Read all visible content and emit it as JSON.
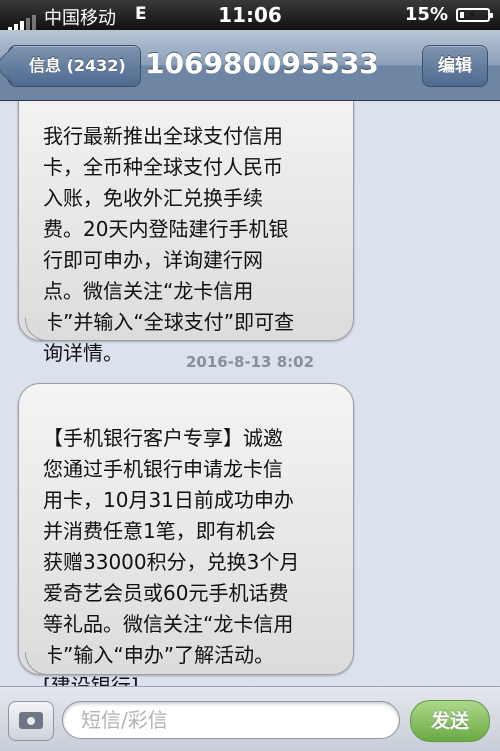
{
  "status_bar": {
    "carrier": "中国移动",
    "network": "E",
    "time": "11:06",
    "battery_percent_text": "15%",
    "battery_level": 0.15
  },
  "nav": {
    "back_label": "信息 (2432)",
    "title": "106980095533",
    "edit_label": "编辑"
  },
  "messages": [
    {
      "text": "我行最新推出全球支付信用\n卡，全币种全球支付人民币\n入账，免收外汇兑换手续\n费。20天内登陆建行手机银\n行即可申办，详询建行网\n点。微信关注“龙卡信用\n卡”并输入“全球支付”即可查\n询详情。"
    },
    {
      "text": "【手机银行客户专享】诚邀\n您通过手机银行申请龙卡信\n用卡，10月31日前成功申办\n并消费任意1笔，即有机会\n获赠33000积分，兑换3个月\n爱奇艺会员或60元手机话费\n等礼品。微信关注“龙卡信用\n卡”输入“申办”了解活动。\n[建设银行]"
    }
  ],
  "timestamp": "2016-8-13 8:02",
  "composer": {
    "placeholder": "短信/彩信",
    "send_label": "发送"
  },
  "icons": {
    "camera": "camera-icon",
    "back": "back-chevron-icon",
    "battery": "battery-charging-icon",
    "signal": "signal-bars-icon"
  },
  "colors": {
    "send_green": "#5aa32a",
    "nav_blue": "#6e86a3",
    "bubble_gray": "#dcdcdc"
  }
}
